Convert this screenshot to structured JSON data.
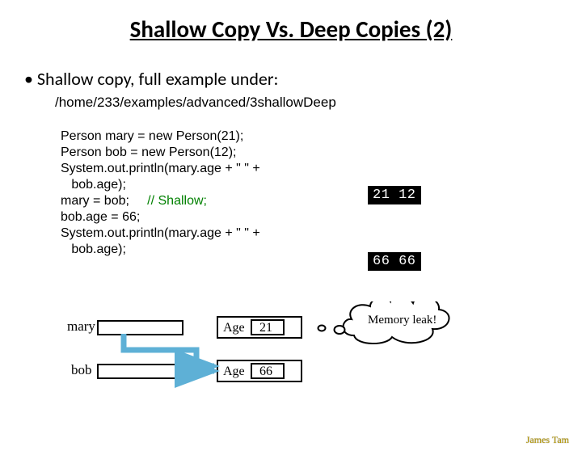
{
  "title": "Shallow Copy Vs. Deep Copies (2)",
  "bullet": "• Shallow copy, full example under:",
  "path": "/home/233/examples/advanced/3shallowDeep",
  "code": {
    "l1": "Person mary = new Person(21);",
    "l2": "Person bob = new Person(12);",
    "l3": "System.out.println(mary.age + \" \" +",
    "l4": "   bob.age);",
    "l5a": "mary = bob;     ",
    "l5b": "// Shallow;",
    "l6": "bob.age = 66;",
    "l7": "System.out.println(mary.age + \" \" +",
    "l8": "   bob.age);"
  },
  "output": {
    "first": "21 12",
    "second": "66 66"
  },
  "diagram": {
    "var1": "mary",
    "var2": "bob",
    "field": "Age",
    "val1": "21",
    "val2": "66",
    "leak": "Memory leak!"
  },
  "footer": "James Tam"
}
